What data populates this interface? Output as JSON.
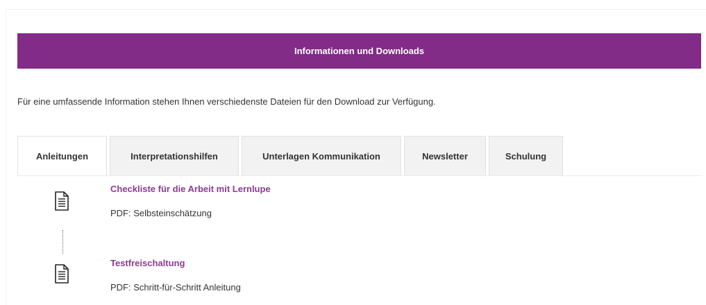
{
  "banner": {
    "title": "Informationen und Downloads",
    "color": "#822b87"
  },
  "intro": {
    "text": "Für eine umfassende Information stehen Ihnen verschiedenste Dateien für den Download zur Verfügung."
  },
  "tabs": [
    {
      "label": "Anleitungen",
      "active": true
    },
    {
      "label": "Interpretationshilfen",
      "active": false
    },
    {
      "label": "Unterlagen Kommunikation",
      "active": false
    },
    {
      "label": "Newsletter",
      "active": false
    },
    {
      "label": "Schulung",
      "active": false
    }
  ],
  "downloads": [
    {
      "icon": "document-icon",
      "title": "Checkliste für die Arbeit mit Lernlupe",
      "description": "PDF: Selbsteinschätzung"
    },
    {
      "icon": "document-icon",
      "title": "Testfreischaltung",
      "description": "PDF: Schritt-für-Schritt Anleitung"
    }
  ],
  "colors": {
    "accent": "#822b87",
    "link": "#8c3a92",
    "tab_inactive": "#f2f2f2"
  }
}
